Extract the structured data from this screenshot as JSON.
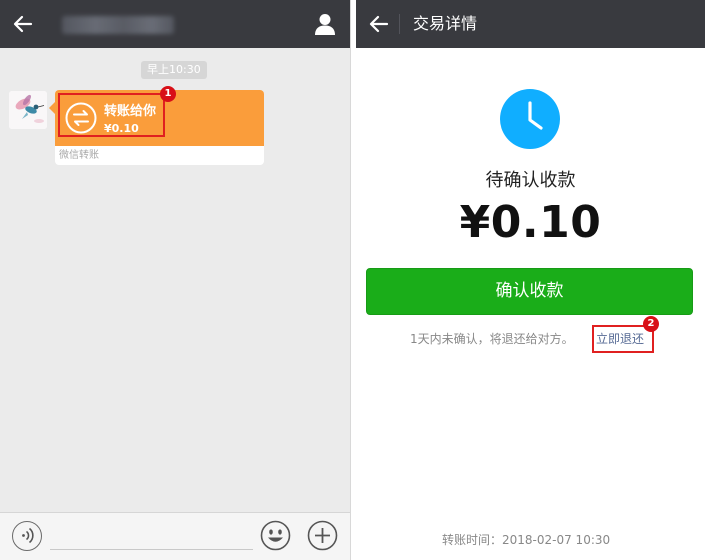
{
  "chat": {
    "timestamp": "早上10:30",
    "transfer_message": {
      "title": "转账给你",
      "amount": "¥0.10",
      "footer": "微信转账",
      "badge": "1"
    }
  },
  "detail": {
    "title": "交易详情",
    "status": "待确认收款",
    "amount": "¥0.10",
    "confirm_button": "确认收款",
    "note": "1天内未确认，将退还给对方。",
    "refund_link": "立即退还",
    "badge": "2",
    "transfer_time": "转账时间：2018-02-07 10:30"
  },
  "icons": {
    "back": "arrow-left-icon",
    "contact": "person-icon",
    "transfer": "transfer-arrows-icon",
    "clock": "clock-icon",
    "voice": "voice-icon",
    "emoji": "emoji-icon",
    "plus": "plus-icon"
  },
  "colors": {
    "topbar": "#393a3f",
    "chat_bg": "#ebebeb",
    "transfer_orange": "#fa9d3b",
    "confirm_green": "#1aad19",
    "clock_blue": "#10aeff",
    "link_blue": "#576b95",
    "annotation_red": "#e02020"
  }
}
